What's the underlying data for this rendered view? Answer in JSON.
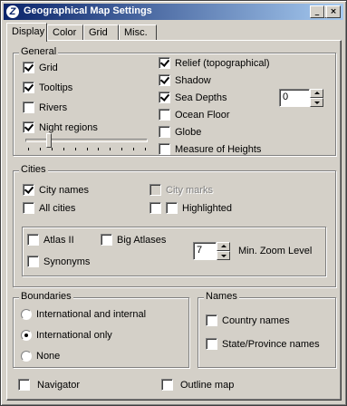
{
  "window": {
    "title": "Geographical Map Settings",
    "controls": {
      "minimize": "_",
      "maximize": "□",
      "close": "×"
    }
  },
  "tabs": [
    {
      "label": "Display",
      "active": true
    },
    {
      "label": "Color",
      "active": false
    },
    {
      "label": "Grid",
      "active": false
    },
    {
      "label": "Misc.",
      "active": false
    }
  ],
  "general": {
    "label": "General",
    "left": [
      {
        "label": "Grid",
        "checked": true
      },
      {
        "label": "Tooltips",
        "checked": true
      },
      {
        "label": "Rivers",
        "checked": false
      },
      {
        "label": "Night regions",
        "checked": true
      }
    ],
    "right": [
      {
        "label": "Relief (topographical)",
        "checked": true
      },
      {
        "label": "Shadow",
        "checked": true
      },
      {
        "label": "Sea Depths",
        "checked": true
      },
      {
        "label": "Ocean Floor",
        "checked": false
      },
      {
        "label": "Globe",
        "checked": false
      },
      {
        "label": "Measure of Heights",
        "checked": false
      }
    ],
    "sea_depth_value": "0",
    "slider_fraction": 0.18
  },
  "cities": {
    "label": "Cities",
    "city_names": {
      "label": "City names",
      "checked": true
    },
    "all_cities": {
      "label": "All cities",
      "checked": false
    },
    "city_marks": {
      "label": "City marks",
      "checked": false,
      "disabled": true
    },
    "highlighted": {
      "label": "Highlighted",
      "checked": false
    },
    "atlas": {
      "label": "Atlas II",
      "checked": false
    },
    "big_atlases": {
      "label": "Big Atlases",
      "checked": false
    },
    "synonyms": {
      "label": "Synonyms",
      "checked": false
    },
    "zoom_value": "7",
    "zoom_label": "Min. Zoom Level"
  },
  "boundaries": {
    "label": "Boundaries",
    "options": [
      {
        "label": "International and internal",
        "selected": false
      },
      {
        "label": "International only",
        "selected": true
      },
      {
        "label": "None",
        "selected": false
      }
    ]
  },
  "names": {
    "label": "Names",
    "options": [
      {
        "label": "Country names",
        "checked": false
      },
      {
        "label": "State/Province names",
        "checked": false
      }
    ]
  },
  "bottom": {
    "navigator": {
      "label": "Navigator",
      "checked": false
    },
    "outline_map": {
      "label": "Outline map",
      "checked": false
    }
  }
}
